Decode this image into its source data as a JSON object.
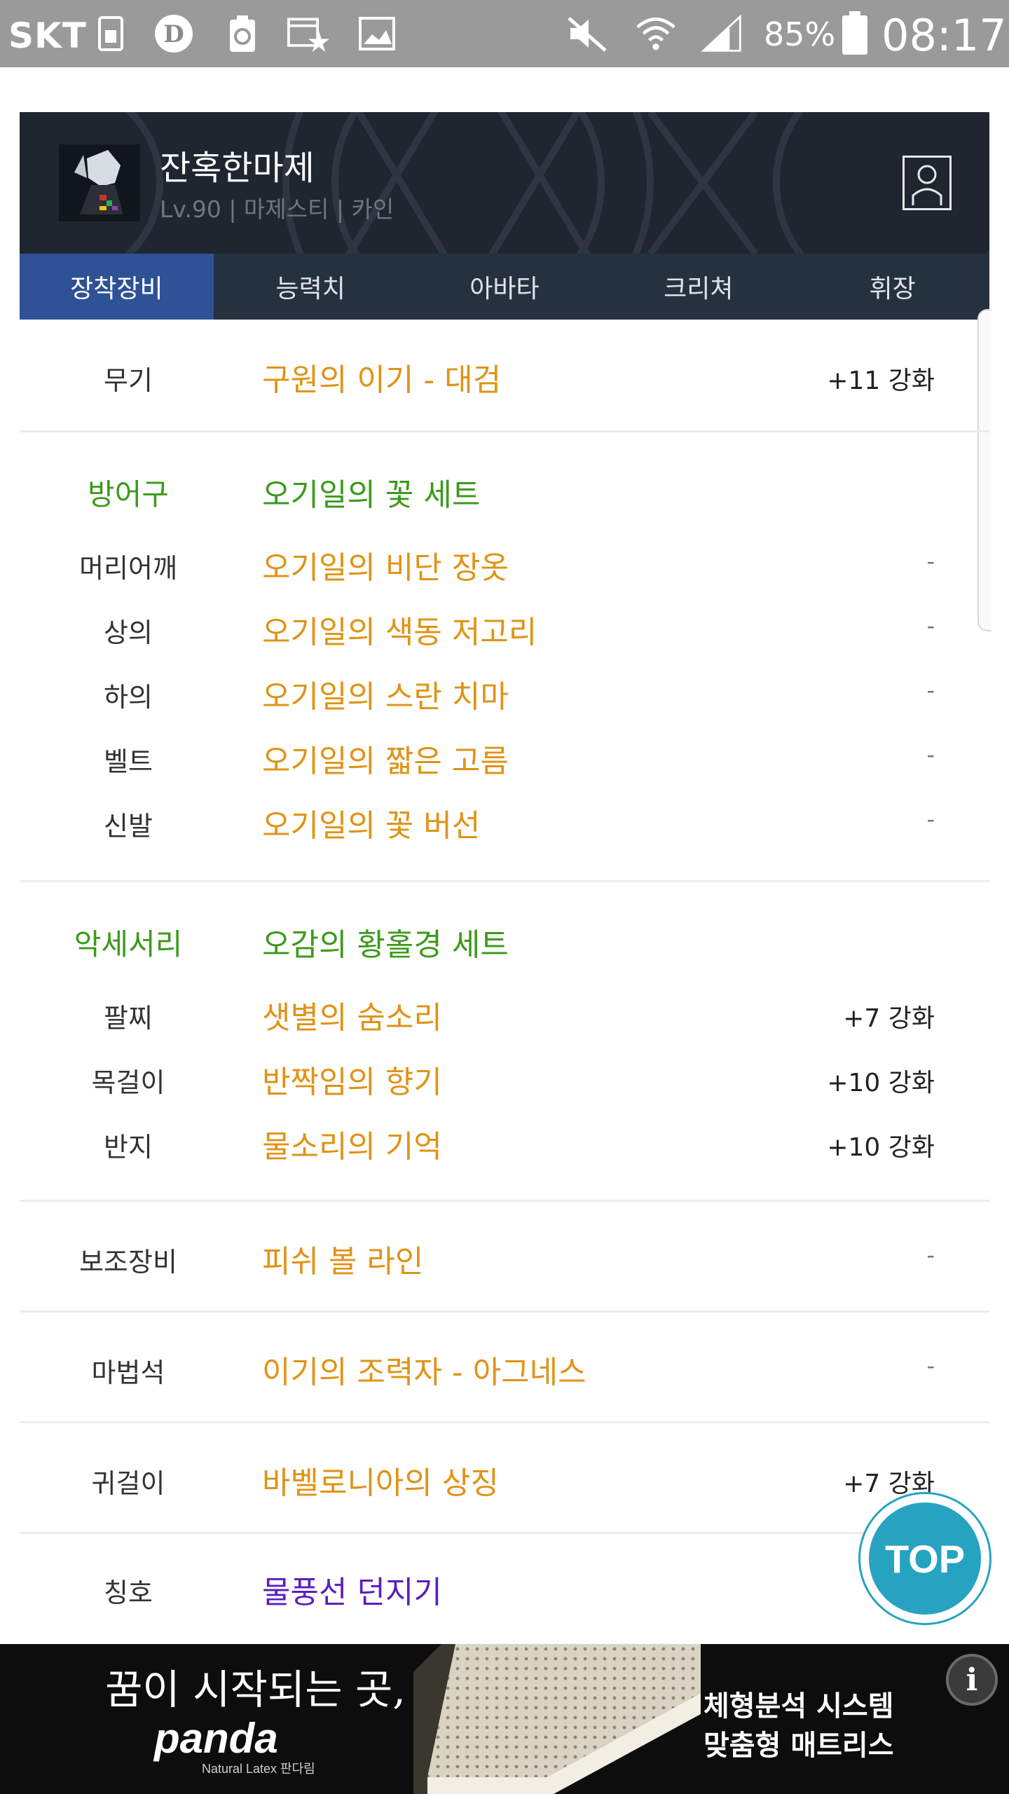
{
  "status_bar": {
    "carrier": "SKT",
    "battery_percent": "85%",
    "time": "08:17"
  },
  "profile": {
    "name": "잔혹한마제",
    "meta": "Lv.90 | 마제스티 | 카인"
  },
  "tabs": [
    {
      "label": "장착장비",
      "active": true
    },
    {
      "label": "능력치",
      "active": false
    },
    {
      "label": "아바타",
      "active": false
    },
    {
      "label": "크리쳐",
      "active": false
    },
    {
      "label": "휘장",
      "active": false
    }
  ],
  "equipment": {
    "weapon": {
      "label": "무기",
      "item": "구원의 이기 - 대검",
      "enhance": "+11 강화"
    },
    "armor": {
      "label": "방어구",
      "set_name": "오기일의 꽃 세트",
      "items": [
        {
          "slot": "머리어깨",
          "item": "오기일의 비단 장옷",
          "enhance": "-"
        },
        {
          "slot": "상의",
          "item": "오기일의 색동 저고리",
          "enhance": "-"
        },
        {
          "slot": "하의",
          "item": "오기일의 스란 치마",
          "enhance": "-"
        },
        {
          "slot": "벨트",
          "item": "오기일의 짧은 고름",
          "enhance": "-"
        },
        {
          "slot": "신발",
          "item": "오기일의 꽃 버선",
          "enhance": "-"
        }
      ]
    },
    "accessory": {
      "label": "악세서리",
      "set_name": "오감의 황홀경 세트",
      "items": [
        {
          "slot": "팔찌",
          "item": "샛별의 숨소리",
          "enhance": "+7 강화"
        },
        {
          "slot": "목걸이",
          "item": "반짝임의 향기",
          "enhance": "+10 강화"
        },
        {
          "slot": "반지",
          "item": "물소리의 기억",
          "enhance": "+10 강화"
        }
      ]
    },
    "sub": {
      "label": "보조장비",
      "item": "피쉬 볼 라인",
      "enhance": "-"
    },
    "magic_stone": {
      "label": "마법석",
      "item": "이기의 조력자 - 아그네스",
      "enhance": "-"
    },
    "earring": {
      "label": "귀걸이",
      "item": "바벨로니아의 상징",
      "enhance": "+7 강화"
    },
    "title": {
      "label": "칭호",
      "item": "물풍선 던지기"
    }
  },
  "top_button": {
    "label": "TOP"
  },
  "ad": {
    "headline": "꿈이 시작되는 곳,",
    "brand": "panda",
    "brand_sub": "Natural Latex 판다림",
    "line1": "체형분석 시스템",
    "line2": "맞춤형 매트리스",
    "info_icon": "i"
  },
  "colors": {
    "item_orange": "#e09316",
    "set_green": "#3c9a1c",
    "title_purple": "#5b1fbf",
    "tab_active": "#2f5195",
    "tab_bg": "#263140",
    "top_button": "#27a3c2"
  }
}
